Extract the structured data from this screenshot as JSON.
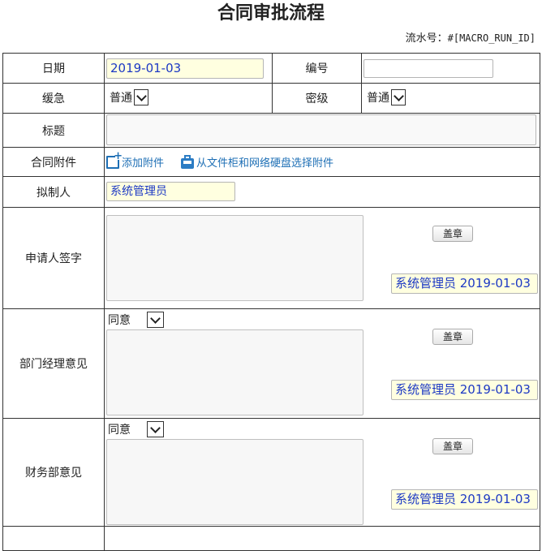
{
  "title": "合同审批流程",
  "serial": {
    "label": "流水号：",
    "value": "#[MACRO_RUN_ID]"
  },
  "rows": {
    "date": {
      "label": "日期",
      "value": "2019-01-03"
    },
    "number": {
      "label": "编号",
      "value": ""
    },
    "urgency": {
      "label": "缓急",
      "value": "普通"
    },
    "secret": {
      "label": "密级",
      "value": "普通"
    },
    "subject": {
      "label": "标题",
      "value": ""
    },
    "attachment": {
      "label": "合同附件",
      "add_label": "添加附件",
      "select_label": "从文件柜和网络硬盘选择附件"
    },
    "drafter": {
      "label": "拟制人",
      "value": "系统管理员"
    },
    "applicant": {
      "label": "申请人签字",
      "stamp_label": "盖章",
      "sign_value": "系统管理员 2019-01-03"
    },
    "dept_manager": {
      "label": "部门经理意见",
      "opinion": "同意",
      "stamp_label": "盖章",
      "sign_value": "系统管理员 2019-01-03"
    },
    "finance": {
      "label": "财务部意见",
      "opinion": "同意",
      "stamp_label": "盖章",
      "sign_value": "系统管理员 2019-01-03"
    }
  },
  "colors": {
    "field_highlight": "#ffffe0",
    "field_text": "#1d39c4",
    "link": "#1e6fb5"
  },
  "icons": {
    "add_attachment": "add-attachment-icon",
    "select_from_disk": "disk-icon"
  }
}
